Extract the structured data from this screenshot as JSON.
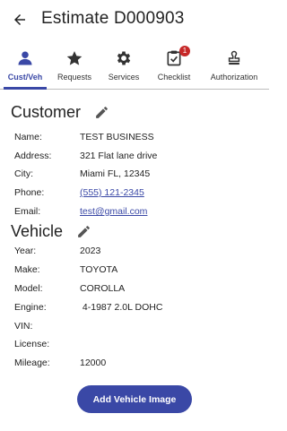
{
  "header": {
    "title": "Estimate D000903",
    "back_icon": "arrow-left-icon"
  },
  "tabs": [
    {
      "label": "Cust/Veh",
      "icon": "person-icon",
      "active": true
    },
    {
      "label": "Requests",
      "icon": "star-icon",
      "active": false
    },
    {
      "label": "Services",
      "icon": "gear-icon",
      "active": false
    },
    {
      "label": "Checklist",
      "icon": "checklist-icon",
      "active": false,
      "badge": "1"
    },
    {
      "label": "Authorization",
      "icon": "stamp-icon",
      "active": false
    }
  ],
  "customer": {
    "title": "Customer",
    "fields": [
      {
        "label": "Name:",
        "value": "TEST BUSINESS"
      },
      {
        "label": "Address:",
        "value": "321 Flat lane drive"
      },
      {
        "label": "City:",
        "value": "Miami FL, 12345"
      },
      {
        "label": "Phone:",
        "value": "(555) 121-2345"
      },
      {
        "label": "Email:",
        "value": "test@gmail.com"
      }
    ]
  },
  "vehicle": {
    "title": "Vehicle",
    "fields": [
      {
        "label": "Year:",
        "value": "2023"
      },
      {
        "label": "Make:",
        "value": "TOYOTA"
      },
      {
        "label": "Model:",
        "value": "COROLLA"
      },
      {
        "label": "Engine:",
        "value": " 4-1987 2.0L DOHC"
      },
      {
        "label": "VIN:",
        "value": ""
      },
      {
        "label": "License:",
        "value": ""
      },
      {
        "label": "Mileage:",
        "value": "12000"
      }
    ]
  },
  "actions": {
    "add_vehicle_image": "Add Vehicle Image"
  },
  "colors": {
    "accent": "#3a48a6",
    "badge": "#c62828"
  }
}
